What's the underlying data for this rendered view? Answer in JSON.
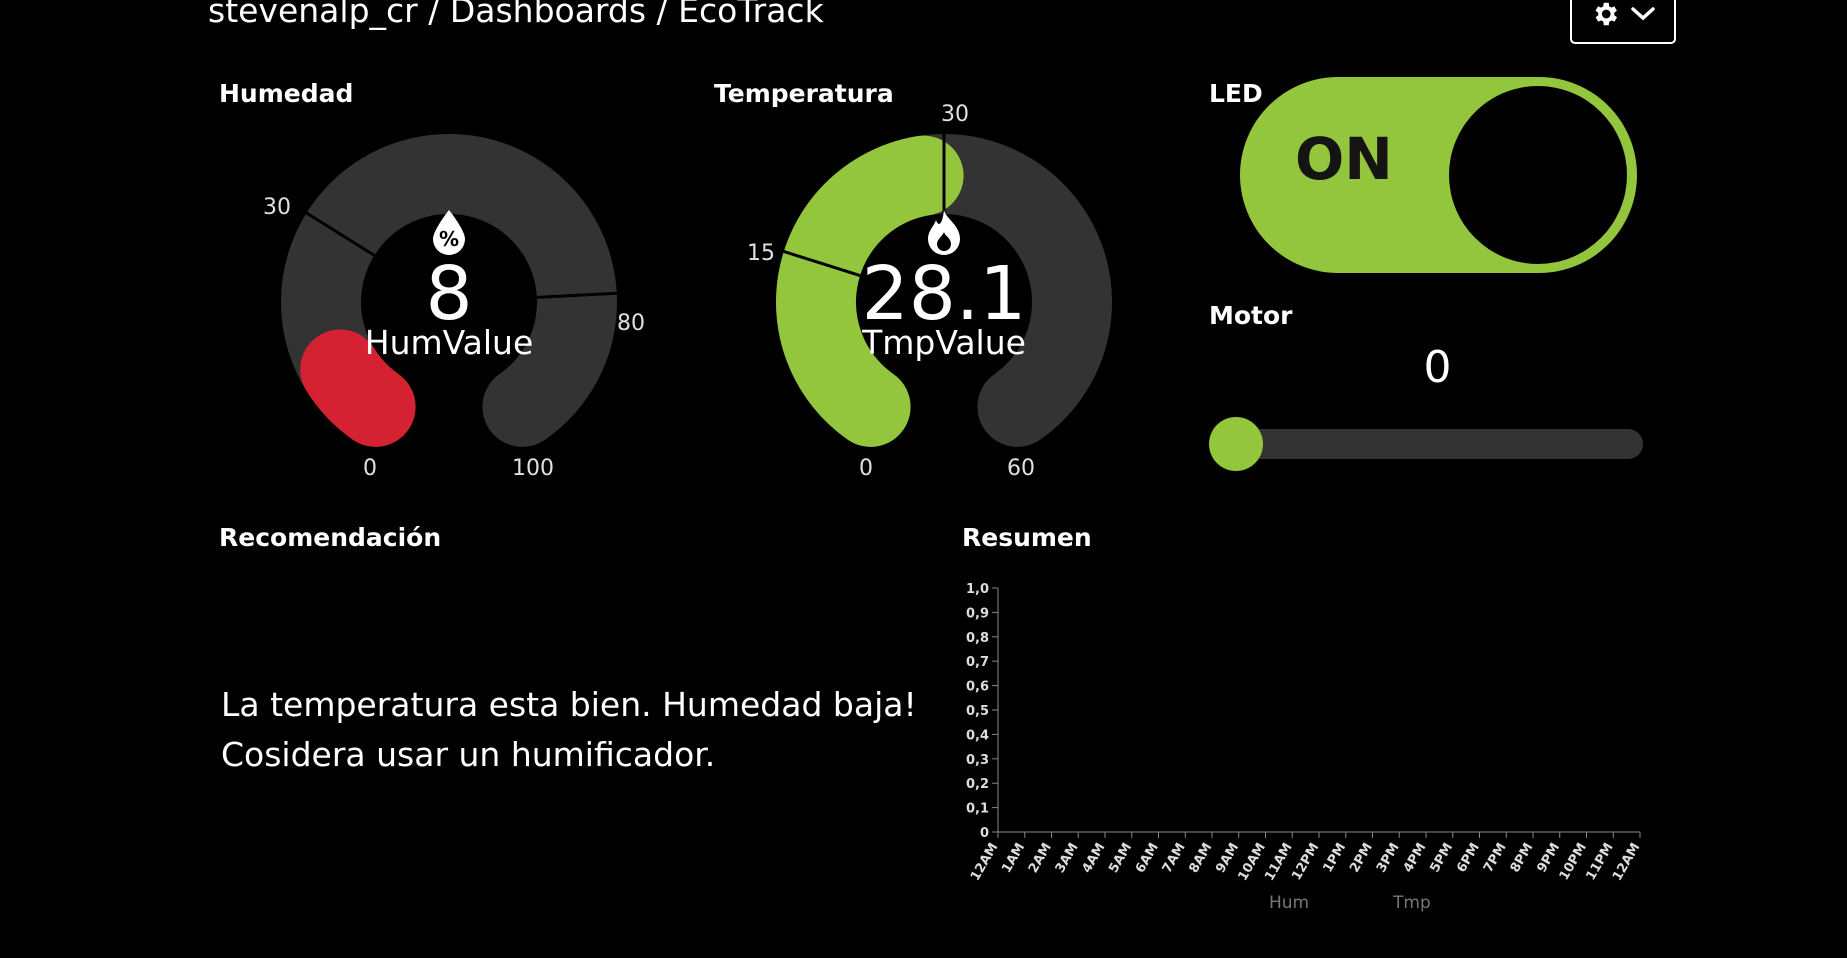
{
  "header": {
    "breadcrumb": "stevenalp_cr / Dashboards / EcoTrack"
  },
  "settings": {
    "icon": "gear-icon",
    "chevron": "chevron-down-icon"
  },
  "humedad": {
    "title": "Humedad",
    "value": "8",
    "label": "HumValue",
    "icon": "percent-drop-icon",
    "min": 0,
    "max": 100,
    "thresholds": [
      30,
      80
    ],
    "tick_labels": [
      "0",
      "30",
      "80",
      "100"
    ],
    "color": "#d42233",
    "level": 8
  },
  "temperatura": {
    "title": "Temperatura",
    "value": "28.1",
    "label": "TmpValue",
    "icon": "flame-icon",
    "min": 0,
    "max": 60,
    "thresholds": [
      15,
      30
    ],
    "tick_labels": [
      "0",
      "15",
      "30",
      "60"
    ],
    "color": "#93c63d",
    "level": 28.1
  },
  "led": {
    "title": "LED",
    "state": "ON",
    "color": "#93c63d"
  },
  "motor": {
    "title": "Motor",
    "value": "0",
    "level": 0,
    "color": "#93c63d"
  },
  "recomendacion": {
    "title": "Recomendación",
    "line1": "La temperatura esta bien. Humedad baja!",
    "line2": "Cosidera usar un humificador."
  },
  "resumen": {
    "title": "Resumen",
    "chart_data": {
      "type": "line",
      "x": [
        "12AM",
        "1AM",
        "2AM",
        "3AM",
        "4AM",
        "5AM",
        "6AM",
        "7AM",
        "8AM",
        "9AM",
        "10AM",
        "11AM",
        "12PM",
        "1PM",
        "2PM",
        "3PM",
        "4PM",
        "5PM",
        "6PM",
        "7PM",
        "8PM",
        "9PM",
        "10PM",
        "11PM",
        "12AM"
      ],
      "y_ticks": [
        "0",
        "0,1",
        "0,2",
        "0,3",
        "0,4",
        "0,5",
        "0,6",
        "0,7",
        "0,8",
        "0,9",
        "1,0"
      ],
      "ylim": [
        0,
        1.0
      ],
      "series": [
        {
          "name": "Hum",
          "values": []
        },
        {
          "name": "Tmp",
          "values": []
        }
      ]
    }
  }
}
